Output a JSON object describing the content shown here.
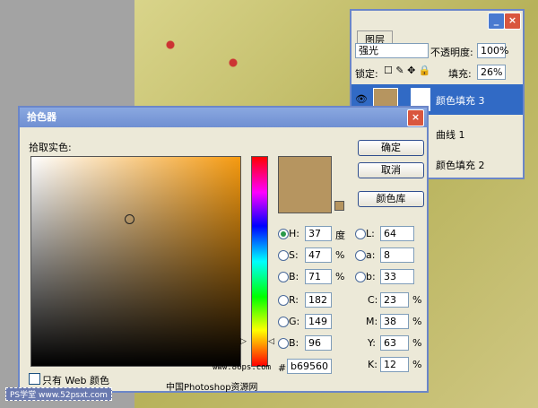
{
  "layers_panel": {
    "tab": "图层",
    "blend_mode": "强光",
    "opacity_label": "不透明度:",
    "opacity": "100%",
    "lock_label": "锁定:",
    "fill_label": "填充:",
    "fill": "26%",
    "layers": [
      {
        "name": "颜色填充 3",
        "selected": true,
        "color": "#b69560"
      },
      {
        "name": "曲线 1"
      },
      {
        "name": "颜色填充 2"
      }
    ]
  },
  "dialog": {
    "title": "拾色器",
    "pick_label": "拾取实色:",
    "ok": "确定",
    "cancel": "取消",
    "library": "颜色库",
    "web_only": "只有 Web 颜色",
    "fields": {
      "H": "37",
      "S": "47",
      "B": "71",
      "L": "64",
      "a": "8",
      "b": "33",
      "R": "182",
      "G": "149",
      "B2": "96",
      "C": "23",
      "M": "38",
      "Y": "63",
      "K": "12",
      "hex": "b69560"
    },
    "labels": {
      "H": "H:",
      "S": "S:",
      "B": "B:",
      "L": "L:",
      "a": "a:",
      "b": "b:",
      "R": "R:",
      "G": "G:",
      "B2": "B:",
      "C": "C:",
      "M": "M:",
      "Y": "Y:",
      "K": "K:",
      "hash": "#",
      "deg": "度",
      "pct": "%"
    },
    "current_color": "#b69560",
    "hue_deg": 37
  },
  "watermarks": {
    "site1": "www.86ps.com",
    "site1_name": "中国Photoshop资源网",
    "site2": "PS学堂 www.52psxt.com"
  }
}
